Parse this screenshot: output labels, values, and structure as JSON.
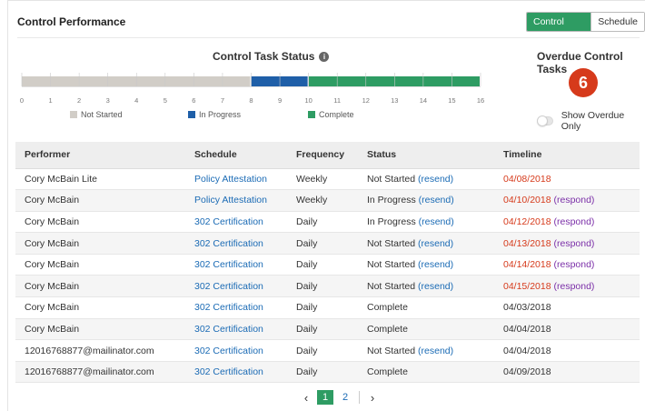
{
  "header": {
    "title": "Control Performance",
    "view_tabs": [
      {
        "label": "Control Task",
        "active": true
      },
      {
        "label": "Schedule",
        "active": false
      }
    ]
  },
  "status_chart": {
    "title": "Control Task Status",
    "info_icon": "info-icon"
  },
  "chart_data": {
    "type": "bar",
    "orientation": "horizontal-stacked",
    "title": "Control Task Status",
    "xlim": [
      0,
      16
    ],
    "x_ticks": [
      "0",
      "1",
      "2",
      "3",
      "4",
      "5",
      "6",
      "7",
      "8",
      "9",
      "10",
      "11",
      "12",
      "13",
      "14",
      "15",
      "16"
    ],
    "series": [
      {
        "name": "Not Started",
        "value": 8,
        "color": "#d1cdc7"
      },
      {
        "name": "In Progress",
        "value": 2,
        "color": "#1f5fa8"
      },
      {
        "name": "Complete",
        "value": 6,
        "color": "#2e9c63"
      }
    ],
    "legend_position": "bottom"
  },
  "overdue": {
    "title": "Overdue Control Tasks",
    "count": "6",
    "toggle_label": "Show Overdue Only",
    "toggle_on": false
  },
  "table": {
    "columns": [
      "Performer",
      "Schedule",
      "Frequency",
      "Status",
      "Timeline"
    ],
    "rows": [
      {
        "performer": "Cory McBain Lite",
        "schedule": "Policy Attestation",
        "frequency": "Weekly",
        "status": "Not Started",
        "action": "(resend)",
        "timeline": "04/08/2018",
        "overdue": true,
        "respond": ""
      },
      {
        "performer": "Cory McBain",
        "schedule": "Policy Attestation",
        "frequency": "Weekly",
        "status": "In Progress",
        "action": "(resend)",
        "timeline": "04/10/2018",
        "overdue": true,
        "respond": "(respond)"
      },
      {
        "performer": "Cory McBain",
        "schedule": "302 Certification",
        "frequency": "Daily",
        "status": "In Progress",
        "action": "(resend)",
        "timeline": "04/12/2018",
        "overdue": true,
        "respond": "(respond)"
      },
      {
        "performer": "Cory McBain",
        "schedule": "302 Certification",
        "frequency": "Daily",
        "status": "Not Started",
        "action": "(resend)",
        "timeline": "04/13/2018",
        "overdue": true,
        "respond": "(respond)"
      },
      {
        "performer": "Cory McBain",
        "schedule": "302 Certification",
        "frequency": "Daily",
        "status": "Not Started",
        "action": "(resend)",
        "timeline": "04/14/2018",
        "overdue": true,
        "respond": "(respond)"
      },
      {
        "performer": "Cory McBain",
        "schedule": "302 Certification",
        "frequency": "Daily",
        "status": "Not Started",
        "action": "(resend)",
        "timeline": "04/15/2018",
        "overdue": true,
        "respond": "(respond)"
      },
      {
        "performer": "Cory McBain",
        "schedule": "302 Certification",
        "frequency": "Daily",
        "status": "Complete",
        "action": "",
        "timeline": "04/03/2018",
        "overdue": false,
        "respond": ""
      },
      {
        "performer": "Cory McBain",
        "schedule": "302 Certification",
        "frequency": "Daily",
        "status": "Complete",
        "action": "",
        "timeline": "04/04/2018",
        "overdue": false,
        "respond": ""
      },
      {
        "performer": "12016768877@mailinator.com",
        "schedule": "302 Certification",
        "frequency": "Daily",
        "status": "Not Started",
        "action": "(resend)",
        "timeline": "04/04/2018",
        "overdue": false,
        "respond": ""
      },
      {
        "performer": "12016768877@mailinator.com",
        "schedule": "302 Certification",
        "frequency": "Daily",
        "status": "Complete",
        "action": "",
        "timeline": "04/09/2018",
        "overdue": false,
        "respond": ""
      }
    ]
  },
  "pagination": {
    "prev": "‹",
    "next": "›",
    "pages": [
      "1",
      "2"
    ],
    "current": "1"
  },
  "colors": {
    "accent_green": "#2e9c63",
    "link_blue": "#1b6bb5",
    "overdue_red": "#d63a1b",
    "respond_purple": "#7b2fa8"
  }
}
